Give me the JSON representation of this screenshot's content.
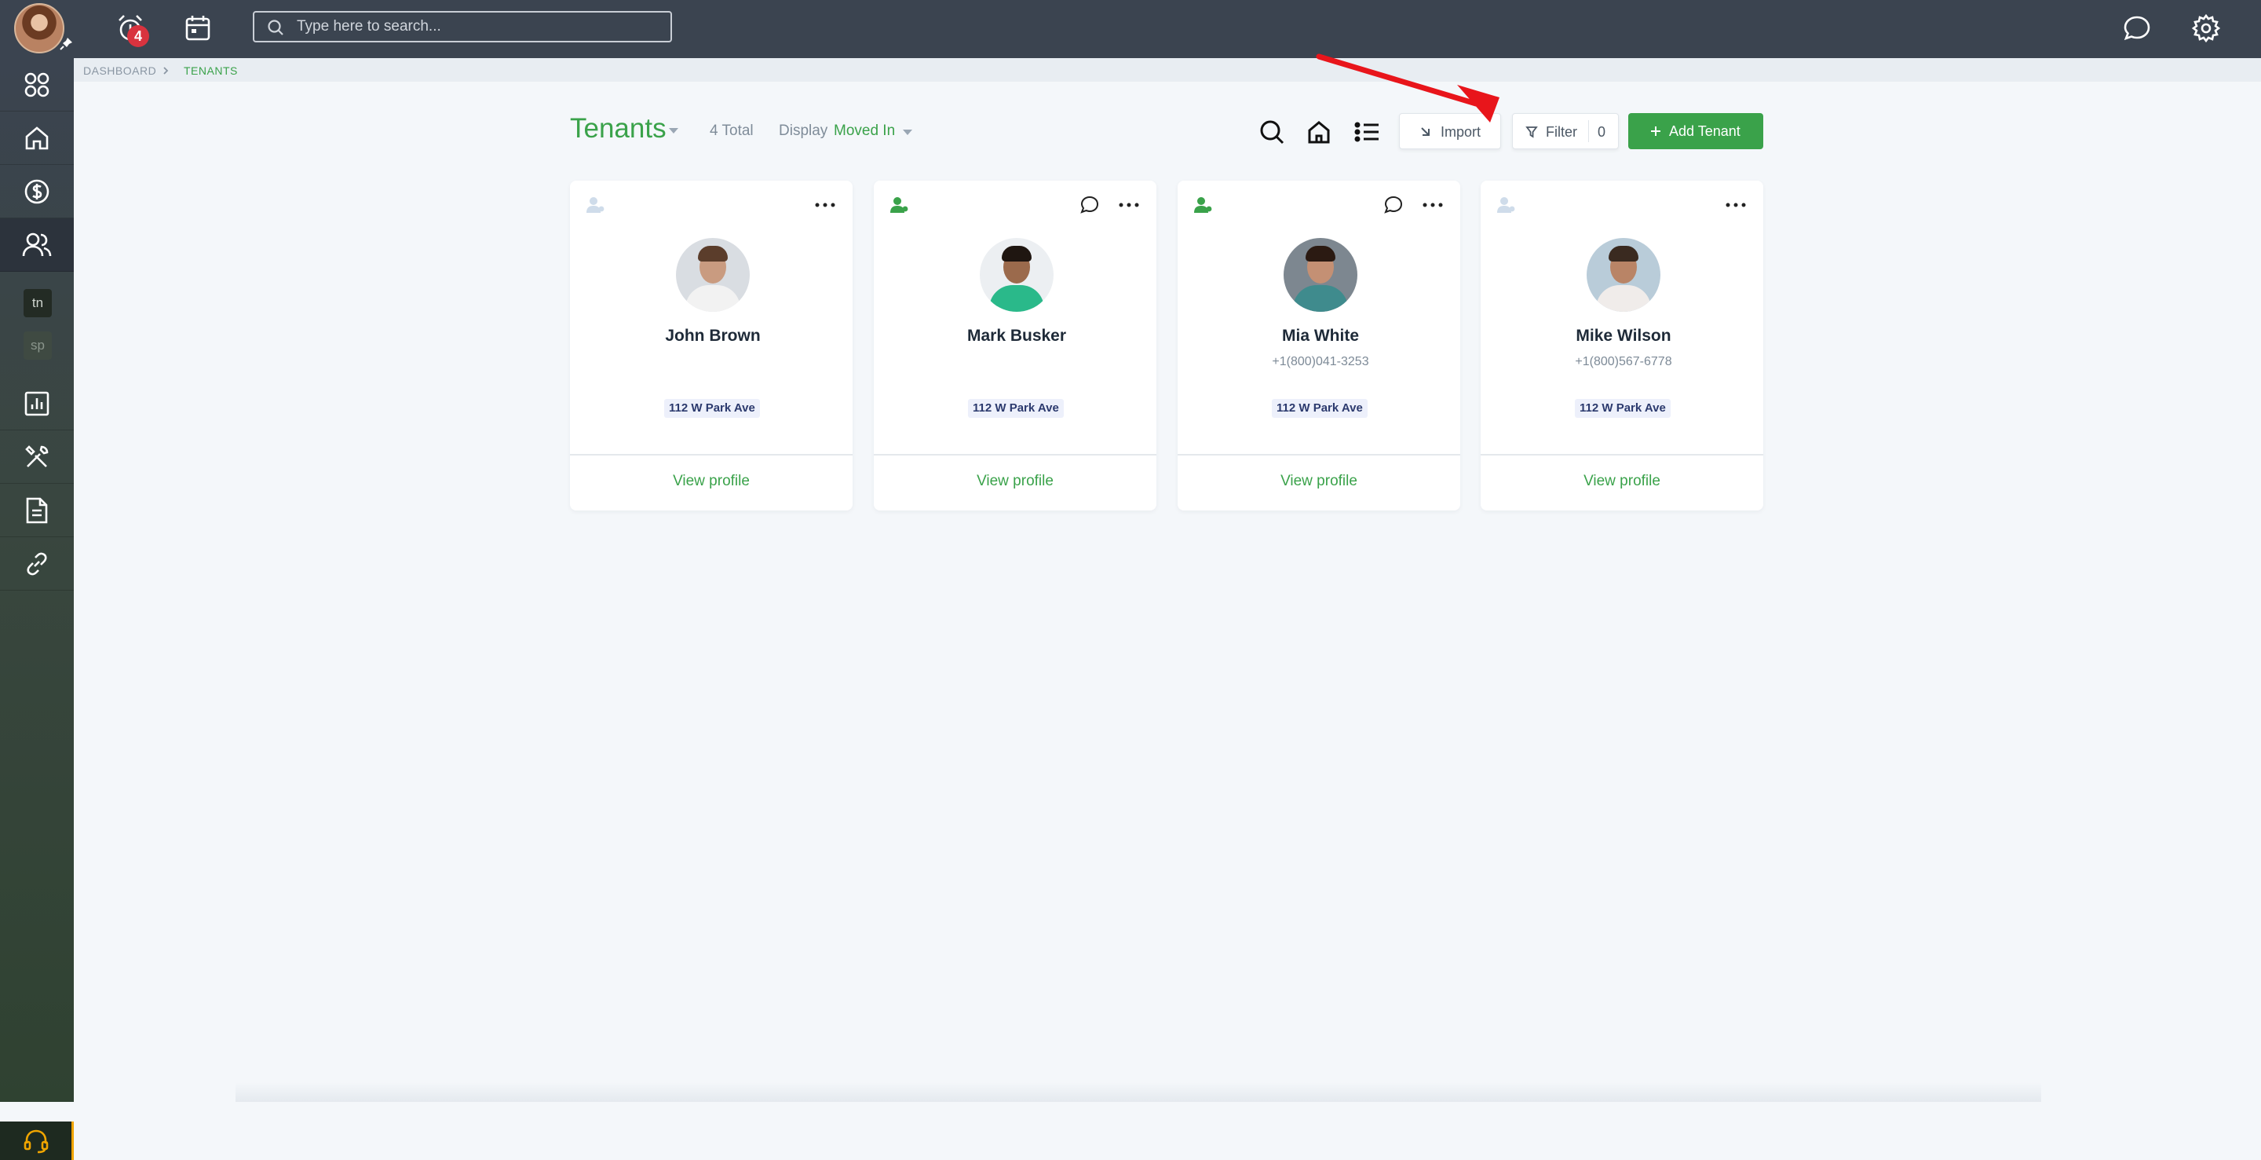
{
  "header": {
    "search_placeholder": "Type here to search...",
    "notification_count": "4"
  },
  "sidebar": {
    "tags": [
      "tn",
      "sp"
    ]
  },
  "breadcrumb": {
    "root": "DASHBOARD",
    "current": "TENANTS"
  },
  "page": {
    "title": "Tenants",
    "total": "4 Total",
    "display_label": "Display",
    "display_value": "Moved In",
    "import_label": "Import",
    "filter_label": "Filter",
    "filter_count": "0",
    "add_label": "Add Tenant"
  },
  "tenants": [
    {
      "name": "John Brown",
      "phone": "",
      "address": "112 W Park Ave",
      "action": "View profile"
    },
    {
      "name": "Mark Busker",
      "phone": "",
      "address": "112 W Park Ave",
      "action": "View profile"
    },
    {
      "name": "Mia White",
      "phone": "+1(800)041-3253",
      "address": "112 W Park Ave",
      "action": "View profile"
    },
    {
      "name": "Mike Wilson",
      "phone": "+1(800)567-6778",
      "address": "112 W Park Ave",
      "action": "View profile"
    }
  ],
  "colors": {
    "brand_green": "#3aa24a",
    "topbar": "#3b4450",
    "annotation_arrow": "#e8151b"
  }
}
